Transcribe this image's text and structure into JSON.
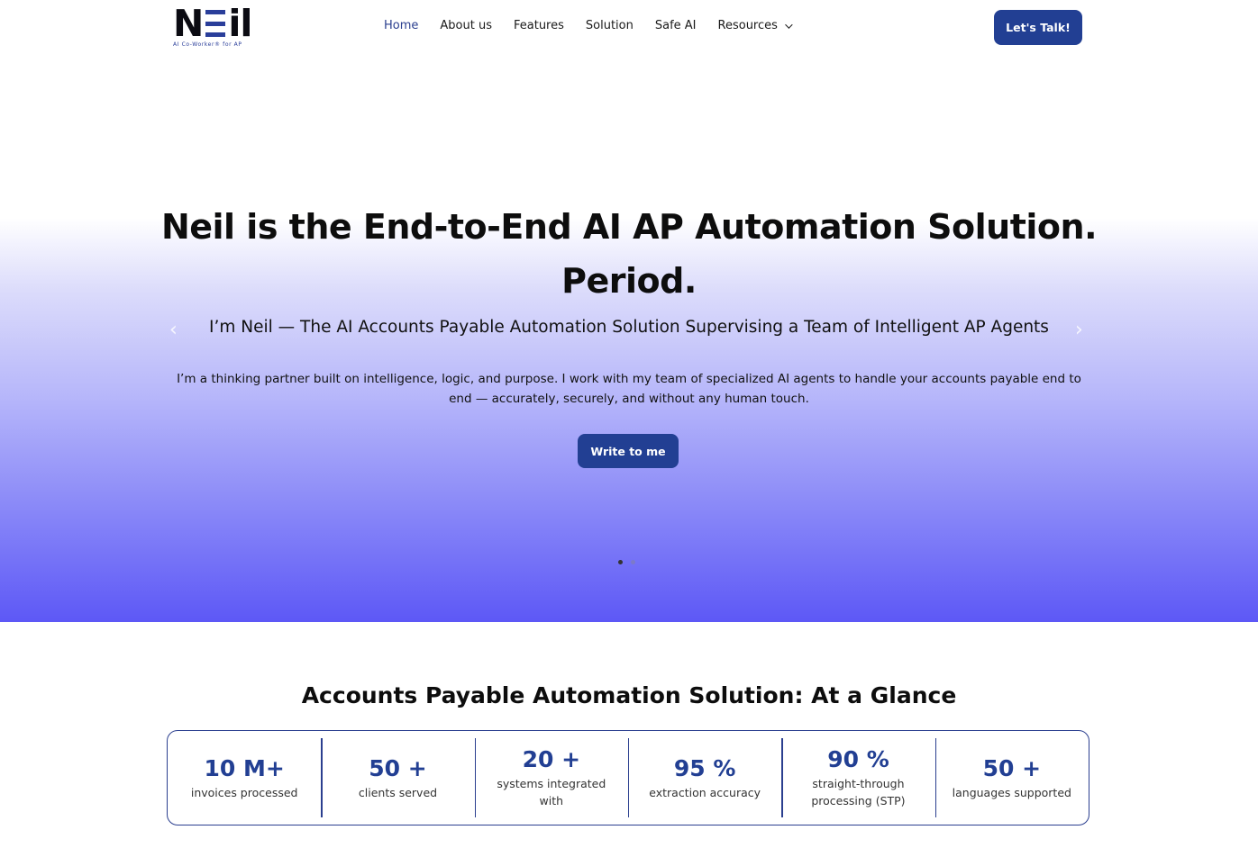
{
  "header": {
    "logo_text_left": "N",
    "logo_text_right": "il",
    "logo_tagline": "AI Co-Worker® for AP",
    "nav": [
      {
        "label": "Home",
        "active": true
      },
      {
        "label": "About us"
      },
      {
        "label": "Features"
      },
      {
        "label": "Solution"
      },
      {
        "label": "Safe AI"
      },
      {
        "label": "Resources",
        "has_dropdown": true
      }
    ],
    "cta_label": "Let's Talk!"
  },
  "hero": {
    "title": "Neil is the End-to-End AI AP Automation Solution. Period.",
    "subtitle": "I’m Neil — The AI Accounts Payable Automation Solution Supervising a Team of Intelligent AP Agents",
    "body": "I’m a thinking partner built on intelligence, logic, and purpose. I work with my team of specialized AI agents to handle your accounts payable end to end — accurately, securely, and without any human touch.",
    "button_label": "Write to me",
    "prev_arrow": "‹",
    "next_arrow": "›",
    "slides_total": 2,
    "slide_active": 1
  },
  "glance": {
    "title": "Accounts Payable Automation Solution: At a Glance",
    "stats": [
      {
        "value": "10 M+",
        "label": "invoices processed"
      },
      {
        "value": "50 +",
        "label": "clients served"
      },
      {
        "value": "20 +",
        "label": "systems integrated with"
      },
      {
        "value": "95 %",
        "label": "extraction accuracy"
      },
      {
        "value": "90 %",
        "label": "straight-through processing (STP)"
      },
      {
        "value": "50 +",
        "label": "languages supported"
      }
    ]
  },
  "colors": {
    "brand_blue": "#223f93",
    "hero_gradient_end": "#5d58f6"
  }
}
